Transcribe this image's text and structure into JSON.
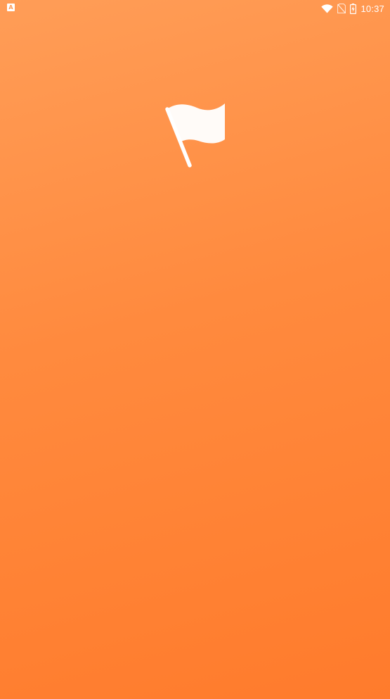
{
  "status_bar": {
    "notification_icon": "text-a-icon",
    "notification_glyph": "A",
    "wifi_icon": "wifi-icon",
    "signal_icon": "no-sim-icon",
    "battery_icon": "battery-charging-icon",
    "time": "10:37"
  },
  "splash": {
    "logo_icon": "flag-icon"
  },
  "colors": {
    "background_top": "#ff9d57",
    "background_bottom": "#ff7b2c",
    "icon": "#ffffff"
  }
}
